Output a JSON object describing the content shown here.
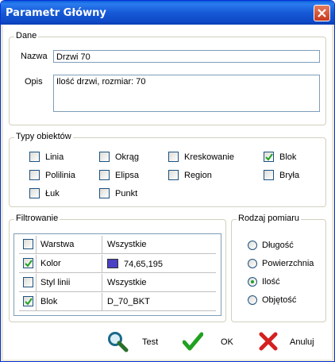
{
  "window": {
    "title": "Parametr Główny"
  },
  "dane": {
    "group_label": "Dane",
    "nazwa_label": "Nazwa",
    "nazwa_value": "Drzwi 70",
    "opis_label": "Opis",
    "opis_value": "Ilość drzwi, rozmiar: 70"
  },
  "typy": {
    "group_label": "Typy obiektów",
    "items": [
      {
        "label": "Linia",
        "checked": false
      },
      {
        "label": "Okrąg",
        "checked": false
      },
      {
        "label": "Kreskowanie",
        "checked": false
      },
      {
        "label": "Blok",
        "checked": true
      },
      {
        "label": "Polilinia",
        "checked": false
      },
      {
        "label": "Elipsa",
        "checked": false
      },
      {
        "label": "Region",
        "checked": false
      },
      {
        "label": "Bryła",
        "checked": false
      },
      {
        "label": "Łuk",
        "checked": false
      },
      {
        "label": "Punkt",
        "checked": false
      }
    ]
  },
  "filtrowanie": {
    "group_label": "Filtrowanie",
    "rows": [
      {
        "checked": false,
        "name": "Warstwa",
        "value": "Wszystkie"
      },
      {
        "checked": true,
        "name": "Kolor",
        "value": "74,65,195",
        "swatch": "#4a41c3"
      },
      {
        "checked": false,
        "name": "Styl linii",
        "value": "Wszystkie"
      },
      {
        "checked": true,
        "name": "Blok",
        "value": "D_70_BKT"
      }
    ]
  },
  "rodzaj": {
    "group_label": "Rodzaj pomiaru",
    "options": [
      {
        "label": "Długość",
        "selected": false
      },
      {
        "label": "Powierzchnia",
        "selected": false
      },
      {
        "label": "Ilość",
        "selected": true
      },
      {
        "label": "Objętość",
        "selected": false
      }
    ]
  },
  "buttons": {
    "test": "Test",
    "ok": "OK",
    "cancel": "Anuluj"
  },
  "colors": {
    "titlebar": "#0a5fd8",
    "ok_green": "#21a121",
    "cancel_red": "#d42020"
  }
}
